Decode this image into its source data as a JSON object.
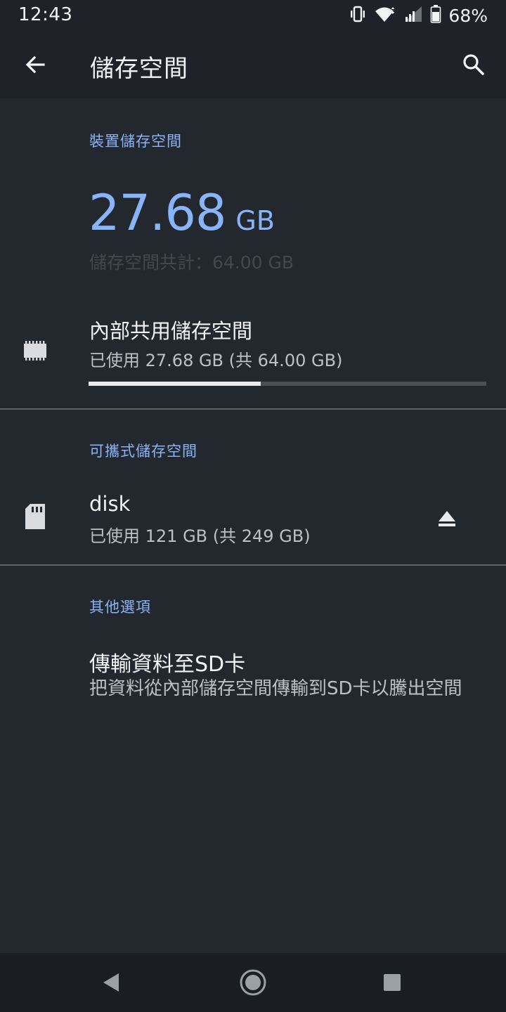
{
  "status_bar": {
    "time": "12:43",
    "battery": "68%",
    "icons": [
      "vibrate-icon",
      "wifi-icon",
      "cell-signal-icon",
      "battery-icon"
    ]
  },
  "toolbar": {
    "title": "儲存空間",
    "back_icon": "arrow-back-icon",
    "search_icon": "search-icon"
  },
  "device_storage": {
    "header": "裝置儲存空間",
    "used_number": "27.68",
    "used_unit": "GB",
    "total_label": "儲存空間共計：64.00 GB"
  },
  "internal_storage": {
    "icon": "memory-chip-icon",
    "title": "內部共用儲存空間",
    "subtitle": "已使用 27.68 GB (共 64.00 GB)",
    "used_fraction": 0.4325
  },
  "portable_storage": {
    "header": "可攜式儲存空間",
    "icon": "sd-card-icon",
    "title": "disk",
    "subtitle": "已使用 121 GB (共 249 GB)",
    "eject_icon": "eject-icon"
  },
  "other_options": {
    "header": "其他選項",
    "title": "傳輸資料至SD卡",
    "subtitle": "把資料從內部儲存空間傳輸到SD卡以騰出空間"
  },
  "nav_bar": {
    "back_icon": "nav-back-icon",
    "home_icon": "nav-home-icon",
    "recents_icon": "nav-recents-icon"
  },
  "colors": {
    "accent": "#8ab4f8",
    "background": "#23272e",
    "toolbar": "#1f2329",
    "divider": "#5f6368"
  }
}
